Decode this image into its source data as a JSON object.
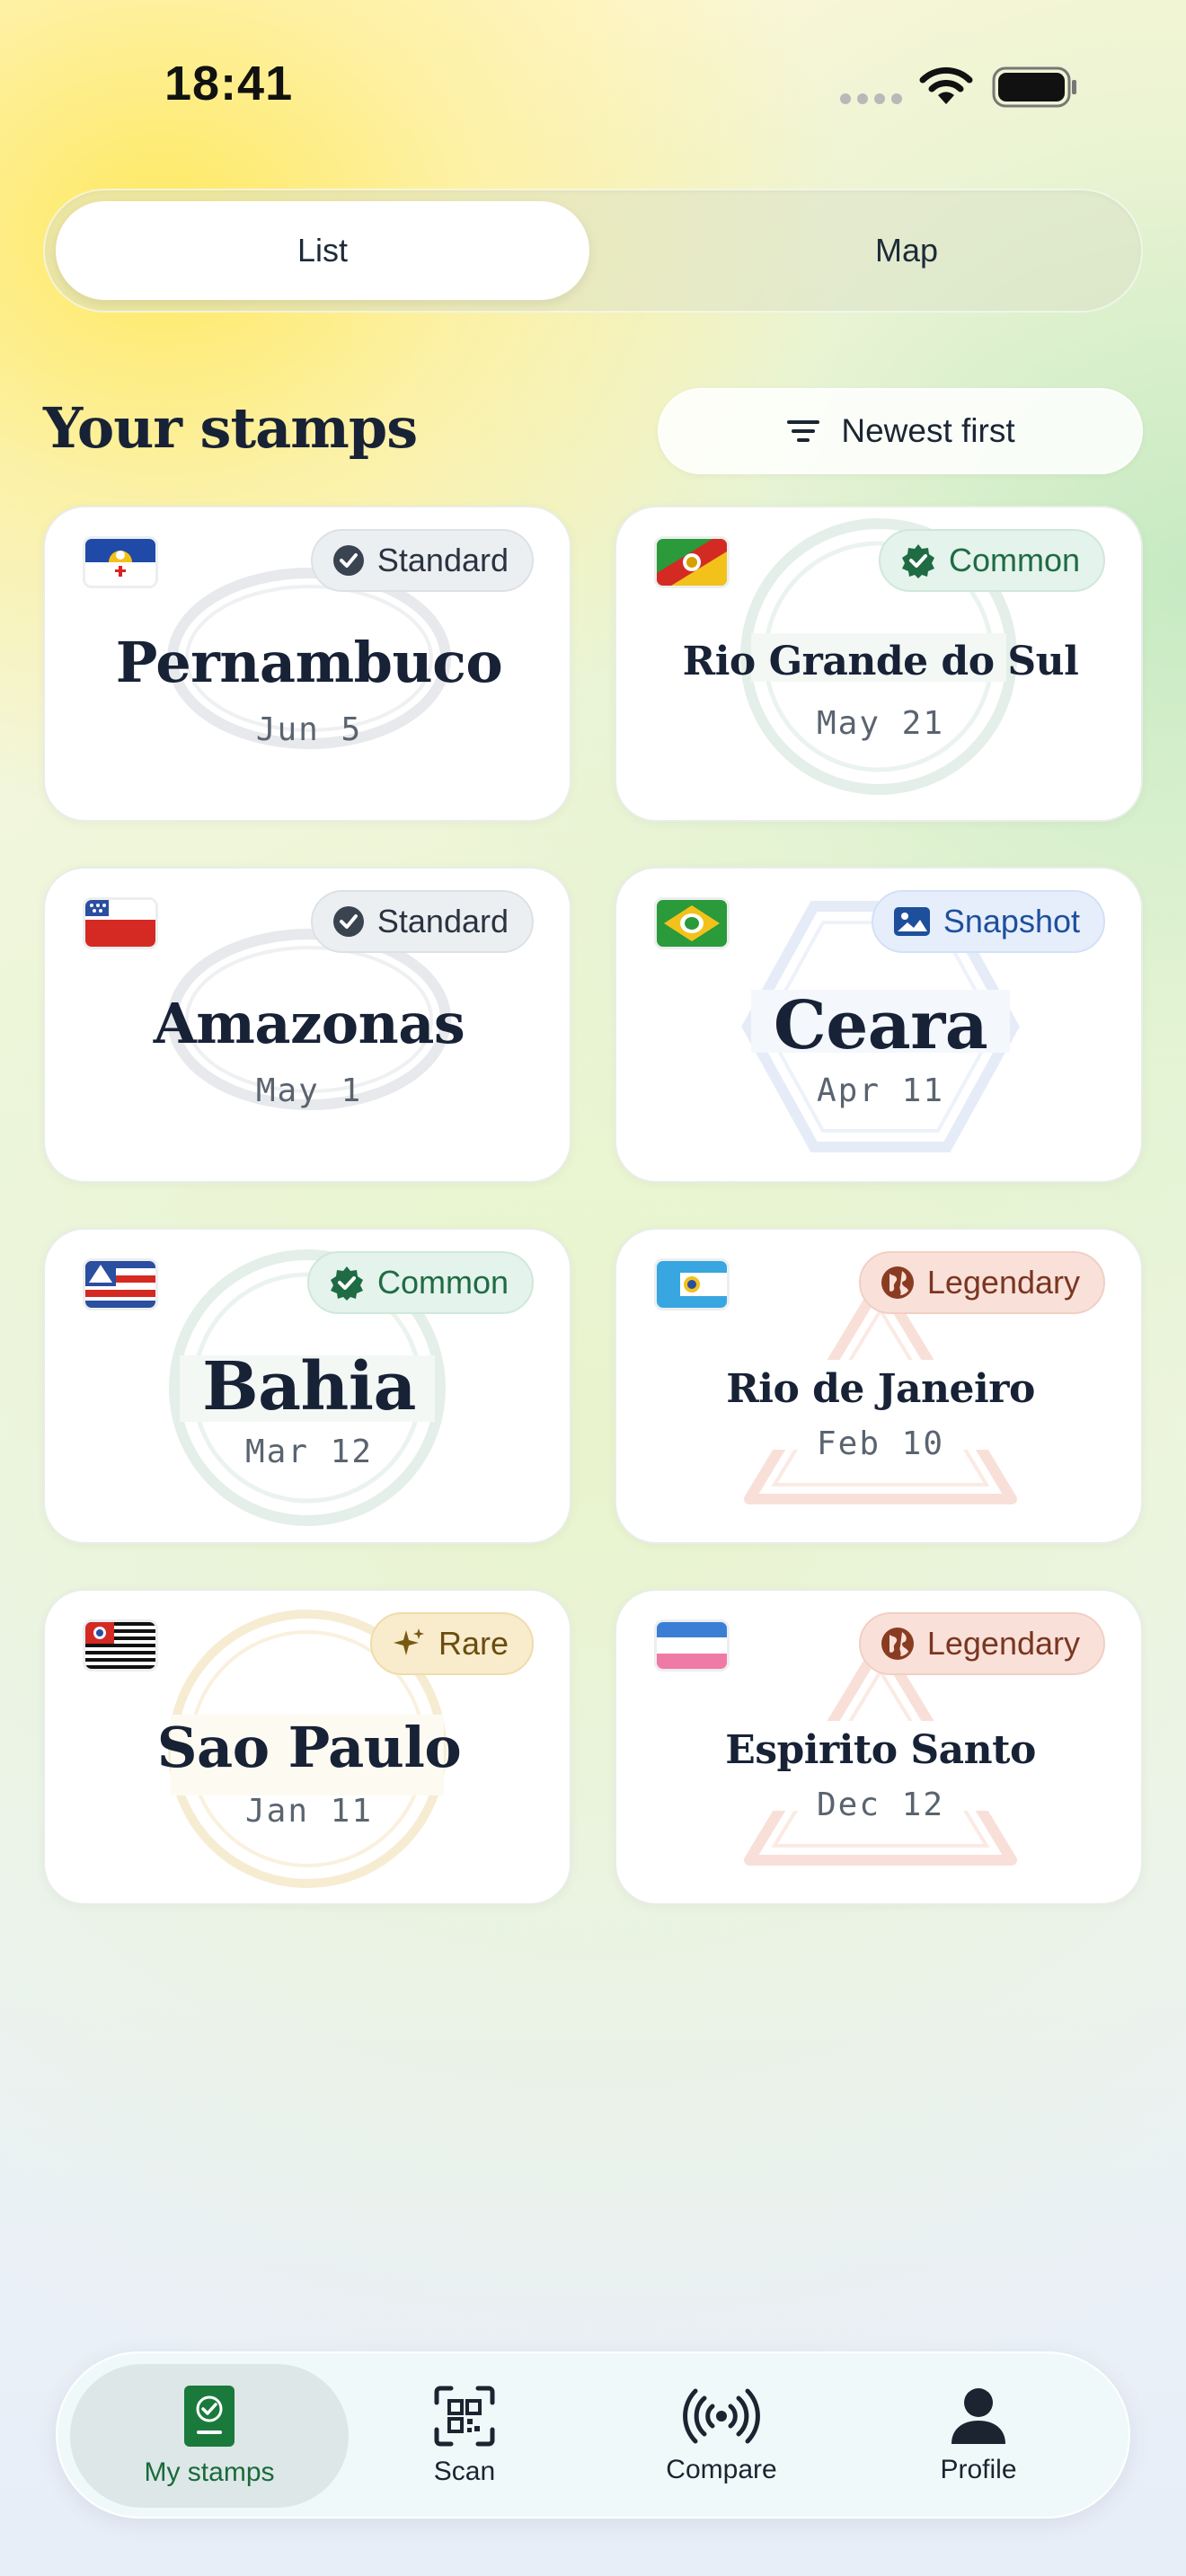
{
  "status_bar": {
    "time": "18:41"
  },
  "view_switcher": {
    "list_label": "List",
    "map_label": "Map",
    "selected": "List"
  },
  "header": {
    "title": "Your stamps",
    "sort_label": "Newest first"
  },
  "stamps": [
    {
      "name": "Pernambuco",
      "date": "Jun 5",
      "badge": "Standard",
      "flag": "pernambuco-flag",
      "stamp_style": "oval"
    },
    {
      "name": "Rio Grande do Sul",
      "date": "May 21",
      "badge": "Common",
      "flag": "rio-grande-do-sul-flag",
      "stamp_style": "round"
    },
    {
      "name": "Amazonas",
      "date": "May 1",
      "badge": "Standard",
      "flag": "amazonas-flag",
      "stamp_style": "oval"
    },
    {
      "name": "Ceara",
      "date": "Apr 11",
      "badge": "Snapshot",
      "flag": "ceara-flag",
      "stamp_style": "hexagon"
    },
    {
      "name": "Bahia",
      "date": "Mar 12",
      "badge": "Common",
      "flag": "bahia-flag",
      "stamp_style": "round"
    },
    {
      "name": "Rio de Janeiro",
      "date": "Feb 10",
      "badge": "Legendary",
      "flag": "rio-de-janeiro-flag",
      "stamp_style": "triangle"
    },
    {
      "name": "Sao Paulo",
      "date": "Jan 11",
      "badge": "Rare",
      "flag": "sao-paulo-flag",
      "stamp_style": "round"
    },
    {
      "name": "Espirito Santo",
      "date": "Dec 12",
      "badge": "Legendary",
      "flag": "espirito-santo-flag",
      "stamp_style": "triangle"
    }
  ],
  "tab_bar": {
    "items": [
      {
        "label": "My stamps",
        "icon": "passport-check-icon",
        "active": true
      },
      {
        "label": "Scan",
        "icon": "qr-scan-icon",
        "active": false
      },
      {
        "label": "Compare",
        "icon": "broadcast-icon",
        "active": false
      },
      {
        "label": "Profile",
        "icon": "person-icon",
        "active": false
      }
    ]
  },
  "colors": {
    "standard": "#2b3340",
    "common": "#1f6b44",
    "snapshot": "#1e4f9c",
    "legendary": "#7a3621",
    "rare": "#6c4d0e",
    "tab_active": "#1a6a3a"
  }
}
